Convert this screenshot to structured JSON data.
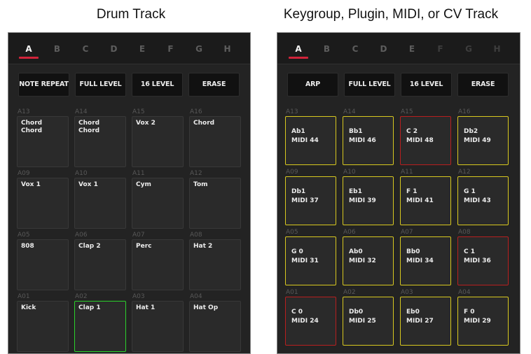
{
  "captions": {
    "drum": "Drum Track",
    "keygroup": "Keygroup, Plugin, MIDI, or CV Track"
  },
  "tabs": [
    "A",
    "B",
    "C",
    "D",
    "E",
    "F",
    "G",
    "H"
  ],
  "drum": {
    "buttons": [
      "NOTE REPEAT",
      "FULL LEVEL",
      "16 LEVEL",
      "ERASE"
    ],
    "rows": [
      [
        {
          "id": "A13",
          "l1": "Chord",
          "l2": "Chord"
        },
        {
          "id": "A14",
          "l1": "Chord",
          "l2": "Chord"
        },
        {
          "id": "A15",
          "l1": "Vox 2",
          "l2": ""
        },
        {
          "id": "A16",
          "l1": "Chord",
          "l2": ""
        }
      ],
      [
        {
          "id": "A09",
          "l1": "Vox 1",
          "l2": ""
        },
        {
          "id": "A10",
          "l1": "Vox 1",
          "l2": ""
        },
        {
          "id": "A11",
          "l1": "Cym",
          "l2": ""
        },
        {
          "id": "A12",
          "l1": "Tom",
          "l2": ""
        }
      ],
      [
        {
          "id": "A05",
          "l1": "808",
          "l2": ""
        },
        {
          "id": "A06",
          "l1": "Clap 2",
          "l2": ""
        },
        {
          "id": "A07",
          "l1": "Perc",
          "l2": ""
        },
        {
          "id": "A08",
          "l1": "Hat 2",
          "l2": ""
        }
      ],
      [
        {
          "id": "A01",
          "l1": "Kick",
          "l2": ""
        },
        {
          "id": "A02",
          "l1": "Clap 1",
          "l2": "",
          "state": "selected"
        },
        {
          "id": "A03",
          "l1": "Hat 1",
          "l2": ""
        },
        {
          "id": "A04",
          "l1": "Hat Op",
          "l2": ""
        }
      ]
    ]
  },
  "keygroup": {
    "buttons": [
      "ARP",
      "FULL LEVEL",
      "16 LEVEL",
      "ERASE"
    ],
    "rows": [
      [
        {
          "id": "A13",
          "l1": "Ab1",
          "l2": "MIDI 44",
          "state": "in-scale"
        },
        {
          "id": "A14",
          "l1": "Bb1",
          "l2": "MIDI 46",
          "state": "in-scale"
        },
        {
          "id": "A15",
          "l1": "C 2",
          "l2": "MIDI 48",
          "state": "root"
        },
        {
          "id": "A16",
          "l1": "Db2",
          "l2": "MIDI 49",
          "state": "in-scale"
        }
      ],
      [
        {
          "id": "A09",
          "l1": "Db1",
          "l2": "MIDI 37",
          "state": "in-scale"
        },
        {
          "id": "A10",
          "l1": "Eb1",
          "l2": "MIDI 39",
          "state": "in-scale"
        },
        {
          "id": "A11",
          "l1": "F 1",
          "l2": "MIDI 41",
          "state": "in-scale"
        },
        {
          "id": "A12",
          "l1": "G 1",
          "l2": "MIDI 43",
          "state": "in-scale"
        }
      ],
      [
        {
          "id": "A05",
          "l1": "G 0",
          "l2": "MIDI 31",
          "state": "in-scale"
        },
        {
          "id": "A06",
          "l1": "Ab0",
          "l2": "MIDI 32",
          "state": "in-scale"
        },
        {
          "id": "A07",
          "l1": "Bb0",
          "l2": "MIDI 34",
          "state": "in-scale"
        },
        {
          "id": "A08",
          "l1": "C 1",
          "l2": "MIDI 36",
          "state": "root"
        }
      ],
      [
        {
          "id": "A01",
          "l1": "C 0",
          "l2": "MIDI 24",
          "state": "root"
        },
        {
          "id": "A02",
          "l1": "Db0",
          "l2": "MIDI 25",
          "state": "in-scale"
        },
        {
          "id": "A03",
          "l1": "Eb0",
          "l2": "MIDI 27",
          "state": "in-scale"
        },
        {
          "id": "A04",
          "l1": "F 0",
          "l2": "MIDI 29",
          "state": "in-scale"
        }
      ]
    ]
  },
  "colors": {
    "active_tab_underline": "#d1233a",
    "selected_pad": "#2bd12b",
    "in_scale_pad": "#d8c81f",
    "root_pad": "#b81f1f",
    "panel_bg": "#232323"
  }
}
